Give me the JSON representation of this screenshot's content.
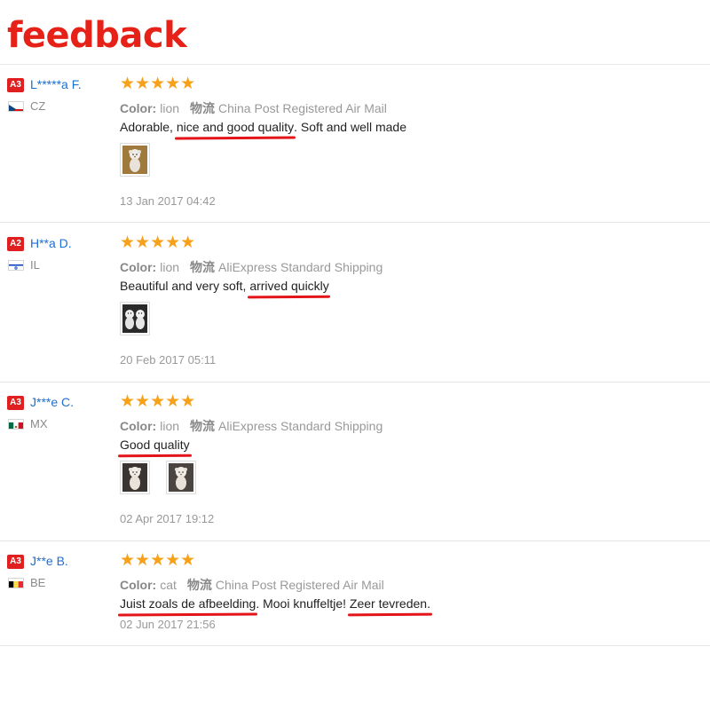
{
  "page": {
    "title": "feedback"
  },
  "reviews": [
    {
      "level": "A3",
      "name": "L*****a F.",
      "country_code": "CZ",
      "country_flag": "cz",
      "rating": 5,
      "stars": "★★★★★",
      "color_label": "Color:",
      "color_value": "lion",
      "shipping_label": "物流",
      "shipping_value": "China Post Registered Air Mail",
      "text_parts": [
        {
          "t": "Adorable, ",
          "hl": false
        },
        {
          "t": "nice and good quality",
          "hl": true
        },
        {
          "t": ". Soft and well made",
          "hl": false
        }
      ],
      "photo_count": 1,
      "photos": [
        "photo-lion-plush"
      ],
      "date": "13 Jan 2017 04:42"
    },
    {
      "level": "A2",
      "name": "H**a D.",
      "country_code": "IL",
      "country_flag": "il",
      "rating": 5,
      "stars": "★★★★★",
      "color_label": "Color:",
      "color_value": "lion",
      "shipping_label": "物流",
      "shipping_value": "AliExpress Standard Shipping",
      "text_parts": [
        {
          "t": "Beautiful and very soft, ",
          "hl": false
        },
        {
          "t": "arrived quickly",
          "hl": true
        }
      ],
      "photo_count": 1,
      "photos": [
        "photo-two-plush"
      ],
      "date": "20 Feb 2017 05:11"
    },
    {
      "level": "A3",
      "name": "J***e C.",
      "country_code": "MX",
      "country_flag": "mx",
      "rating": 5,
      "stars": "★★★★★",
      "color_label": "Color:",
      "color_value": "lion",
      "shipping_label": "物流",
      "shipping_value": "AliExpress Standard Shipping",
      "text_parts": [
        {
          "t": "Good quality",
          "hl": true
        }
      ],
      "photo_count": 2,
      "photos": [
        "photo-plush-dark-a",
        "photo-plush-dark-b"
      ],
      "date": "02 Apr 2017 19:12"
    },
    {
      "level": "A3",
      "name": "J**e B.",
      "country_code": "BE",
      "country_flag": "be",
      "rating": 5,
      "stars": "★★★★★",
      "color_label": "Color:",
      "color_value": "cat",
      "shipping_label": "物流",
      "shipping_value": "China Post Registered Air Mail",
      "text_parts": [
        {
          "t": "Juist zoals de afbeelding",
          "hl": true
        },
        {
          "t": ". Mooi knuffeltje! ",
          "hl": false
        },
        {
          "t": "Zeer tevreden.",
          "hl": true
        }
      ],
      "photo_count": 0,
      "photos": [],
      "date": "02 Jun 2017 21:56"
    }
  ]
}
